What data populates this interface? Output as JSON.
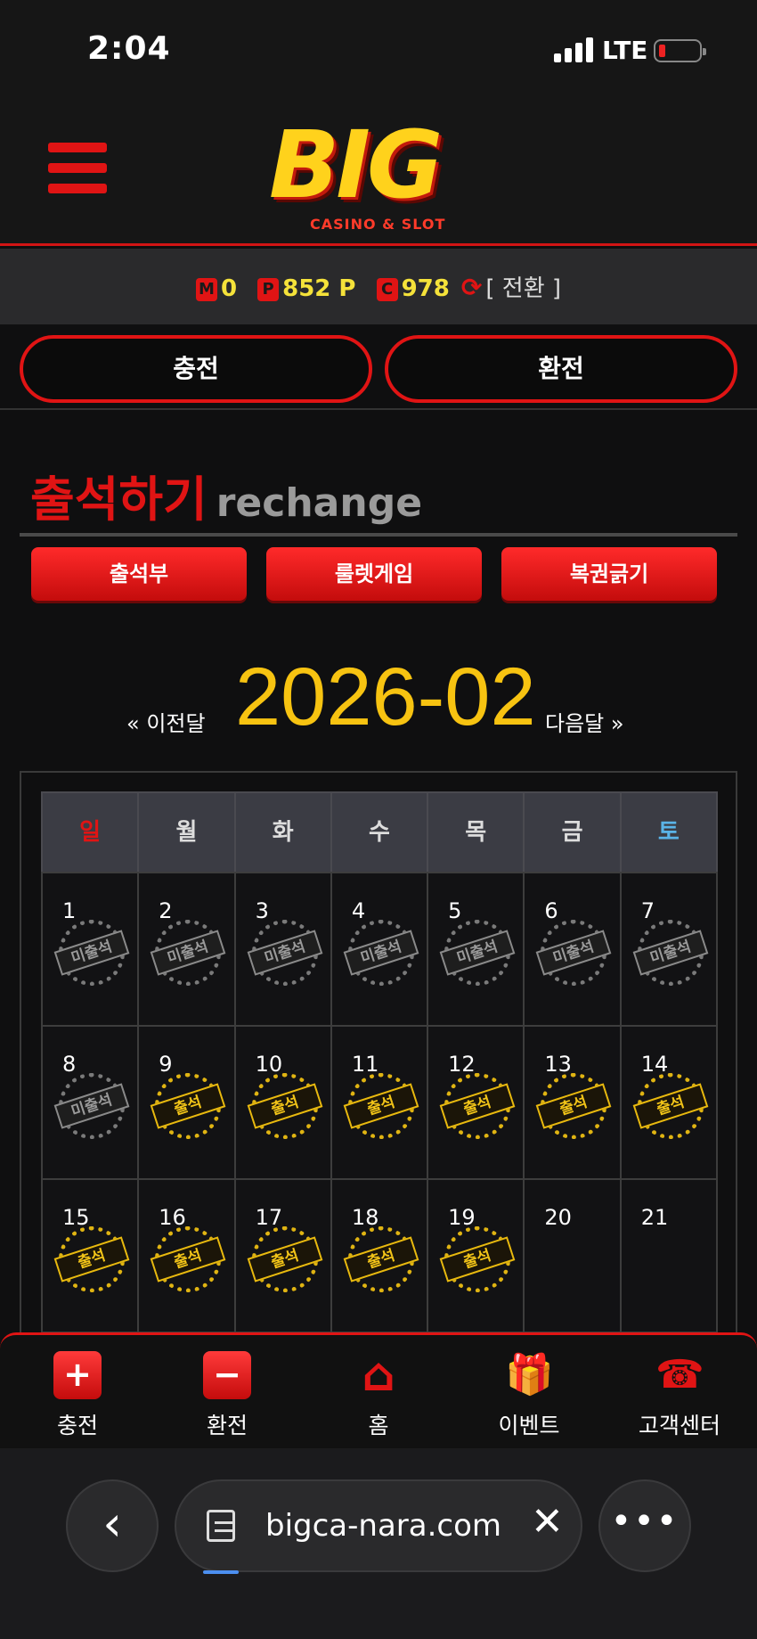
{
  "status_bar": {
    "time": "2:04",
    "network": "LTE"
  },
  "logo": {
    "text": "BIG",
    "sub": "CASINO & SLOT"
  },
  "points": [
    {
      "badge": "M",
      "value": "0"
    },
    {
      "badge": "P",
      "value": "852 P"
    },
    {
      "badge": "C",
      "value": "978"
    }
  ],
  "switch_label": "[ 전환 ]",
  "actions": {
    "charge": "충전",
    "exchange": "환전"
  },
  "section": {
    "title_ko": "출석하기",
    "title_en": "rechange"
  },
  "tabs": [
    "출석부",
    "룰렛게임",
    "복권긁기"
  ],
  "month_nav": {
    "prev": "« 이전달",
    "month": "2026-02",
    "next": "다음달 »"
  },
  "weekdays": [
    "일",
    "월",
    "화",
    "수",
    "목",
    "금",
    "토"
  ],
  "stamp_labels": {
    "absent": "미출석",
    "present": "출석"
  },
  "weeks": [
    [
      {
        "day": "1",
        "status": "absent"
      },
      {
        "day": "2",
        "status": "absent"
      },
      {
        "day": "3",
        "status": "absent"
      },
      {
        "day": "4",
        "status": "absent"
      },
      {
        "day": "5",
        "status": "absent"
      },
      {
        "day": "6",
        "status": "absent"
      },
      {
        "day": "7",
        "status": "absent"
      }
    ],
    [
      {
        "day": "8",
        "status": "absent"
      },
      {
        "day": "9",
        "status": "present"
      },
      {
        "day": "10",
        "status": "present"
      },
      {
        "day": "11",
        "status": "present"
      },
      {
        "day": "12",
        "status": "present"
      },
      {
        "day": "13",
        "status": "present"
      },
      {
        "day": "14",
        "status": "present"
      }
    ],
    [
      {
        "day": "15",
        "status": "present"
      },
      {
        "day": "16",
        "status": "present"
      },
      {
        "day": "17",
        "status": "present"
      },
      {
        "day": "18",
        "status": "present"
      },
      {
        "day": "19",
        "status": "present"
      },
      {
        "day": "20",
        "status": "none"
      },
      {
        "day": "21",
        "status": "none"
      }
    ]
  ],
  "bottom_nav": [
    {
      "label": "충전",
      "icon": "plus-icon"
    },
    {
      "label": "환전",
      "icon": "minus-icon"
    },
    {
      "label": "홈",
      "icon": "home-icon"
    },
    {
      "label": "이벤트",
      "icon": "gift-icon"
    },
    {
      "label": "고객센터",
      "icon": "phone-24-icon"
    }
  ],
  "browser": {
    "url": "bigca-nara.com"
  },
  "colors": {
    "accent": "#e01414",
    "gold": "#f7c311",
    "points": "#f5e23a"
  }
}
